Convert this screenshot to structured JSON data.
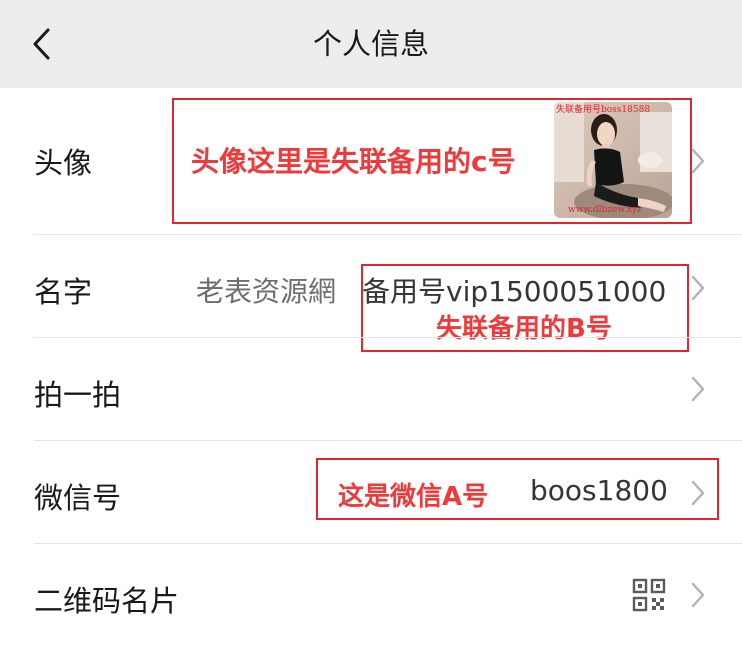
{
  "header": {
    "title": "个人信息",
    "back_icon": "chevron-left-icon"
  },
  "rows": {
    "avatar": {
      "label": "头像",
      "annotation": "头像这里是失联备用的c号",
      "watermark_top": "失联备用号boss18588",
      "watermark_bottom": "www.dlbzew.xyz"
    },
    "name": {
      "label": "名字",
      "value_prefix": "老表资源網",
      "value_main": "备用号vip1500051000",
      "annotation": "失联备用的B号"
    },
    "pat": {
      "label": "拍一拍"
    },
    "wechat_id": {
      "label": "微信号",
      "annotation": "这是微信A号",
      "value": "boos1800"
    },
    "qr_card": {
      "label": "二维码名片",
      "icon": "qr-code-icon"
    }
  },
  "colors": {
    "background": "#ededed",
    "card": "#ffffff",
    "annotation_red": "#e0262f",
    "annotation_text": "#ee3a3a",
    "divider": "#e5e5e5",
    "chevron": "#b2b2b2"
  }
}
